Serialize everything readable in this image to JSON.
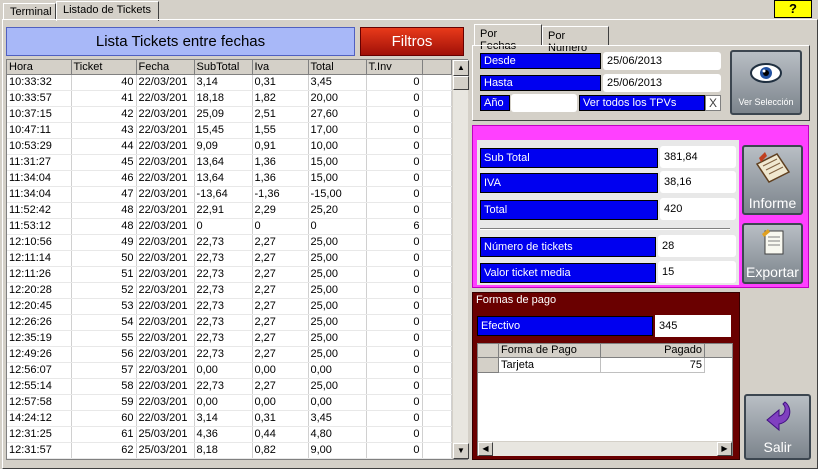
{
  "top_tabs": [
    "Terminal",
    "Listado de Tickets"
  ],
  "help_label": "?",
  "title": "Lista Tickets entre fechas",
  "filtros_label": "Filtros",
  "table": {
    "headers": [
      "Hora",
      "Ticket",
      "Fecha",
      "SubTotal",
      "Iva",
      "Total",
      "T.Inv"
    ],
    "rows": [
      [
        "10:33:32",
        "40",
        "22/03/201",
        "3,14",
        "0,31",
        "3,45",
        "0"
      ],
      [
        "10:33:57",
        "41",
        "22/03/201",
        "18,18",
        "1,82",
        "20,00",
        "0"
      ],
      [
        "10:37:15",
        "42",
        "22/03/201",
        "25,09",
        "2,51",
        "27,60",
        "0"
      ],
      [
        "10:47:11",
        "43",
        "22/03/201",
        "15,45",
        "1,55",
        "17,00",
        "0"
      ],
      [
        "10:53:29",
        "44",
        "22/03/201",
        "9,09",
        "0,91",
        "10,00",
        "0"
      ],
      [
        "11:31:27",
        "45",
        "22/03/201",
        "13,64",
        "1,36",
        "15,00",
        "0"
      ],
      [
        "11:34:04",
        "46",
        "22/03/201",
        "13,64",
        "1,36",
        "15,00",
        "0"
      ],
      [
        "11:34:04",
        "47",
        "22/03/201",
        "-13,64",
        "-1,36",
        "-15,00",
        "0"
      ],
      [
        "11:52:42",
        "48",
        "22/03/201",
        "22,91",
        "2,29",
        "25,20",
        "0"
      ],
      [
        "11:53:12",
        "48",
        "22/03/201",
        "0",
        "0",
        "0",
        "6"
      ],
      [
        "12:10:56",
        "49",
        "22/03/201",
        "22,73",
        "2,27",
        "25,00",
        "0"
      ],
      [
        "12:11:14",
        "50",
        "22/03/201",
        "22,73",
        "2,27",
        "25,00",
        "0"
      ],
      [
        "12:11:26",
        "51",
        "22/03/201",
        "22,73",
        "2,27",
        "25,00",
        "0"
      ],
      [
        "12:20:28",
        "52",
        "22/03/201",
        "22,73",
        "2,27",
        "25,00",
        "0"
      ],
      [
        "12:20:45",
        "53",
        "22/03/201",
        "22,73",
        "2,27",
        "25,00",
        "0"
      ],
      [
        "12:26:26",
        "54",
        "22/03/201",
        "22,73",
        "2,27",
        "25,00",
        "0"
      ],
      [
        "12:35:19",
        "55",
        "22/03/201",
        "22,73",
        "2,27",
        "25,00",
        "0"
      ],
      [
        "12:49:26",
        "56",
        "22/03/201",
        "22,73",
        "2,27",
        "25,00",
        "0"
      ],
      [
        "12:56:07",
        "57",
        "22/03/201",
        "0,00",
        "0,00",
        "0,00",
        "0"
      ],
      [
        "12:55:14",
        "58",
        "22/03/201",
        "22,73",
        "2,27",
        "25,00",
        "0"
      ],
      [
        "12:57:58",
        "59",
        "22/03/201",
        "0,00",
        "0,00",
        "0,00",
        "0"
      ],
      [
        "14:24:12",
        "60",
        "22/03/201",
        "3,14",
        "0,31",
        "3,45",
        "0"
      ],
      [
        "12:31:25",
        "61",
        "25/03/201",
        "4,36",
        "0,44",
        "4,80",
        "0"
      ],
      [
        "12:31:57",
        "62",
        "25/03/201",
        "8,18",
        "0,82",
        "9,00",
        "0"
      ]
    ]
  },
  "right_tabs": [
    "Por Fechas",
    "Por Numero"
  ],
  "filter": {
    "desde_label": "Desde",
    "desde_value": "25/06/2013",
    "hasta_label": "Hasta",
    "hasta_value": "25/06/2013",
    "anio_label": "Año",
    "anio_value": "",
    "tpv_value": "Ver todos los TPVs",
    "clear_symbol": "X",
    "ver_seleccion_label": "Ver Selección"
  },
  "totals": {
    "subtotal_label": "Sub Total",
    "subtotal_value": "381,84",
    "iva_label": "IVA",
    "iva_value": "38,16",
    "total_label": "Total",
    "total_value": "420",
    "num_tickets_label": "Número de tickets",
    "num_tickets_value": "28",
    "ticket_media_label": "Valor ticket media",
    "ticket_media_value": "15"
  },
  "informe_label": "Informe",
  "exportar_label": "Exportar",
  "payments": {
    "title": "Formas de pago",
    "efectivo_label": "Efectivo",
    "efectivo_value": "345",
    "headers": [
      "Forma de Pago",
      "Pagado"
    ],
    "rows": [
      [
        "Tarjeta",
        "75"
      ]
    ]
  },
  "salir_label": "Salir",
  "colors": {
    "label_blue": "#0000f0",
    "magenta": "#ff40ff",
    "maroon": "#6a0000",
    "title_blue": "#a8b8f8",
    "filtros_red": "#c82010"
  }
}
